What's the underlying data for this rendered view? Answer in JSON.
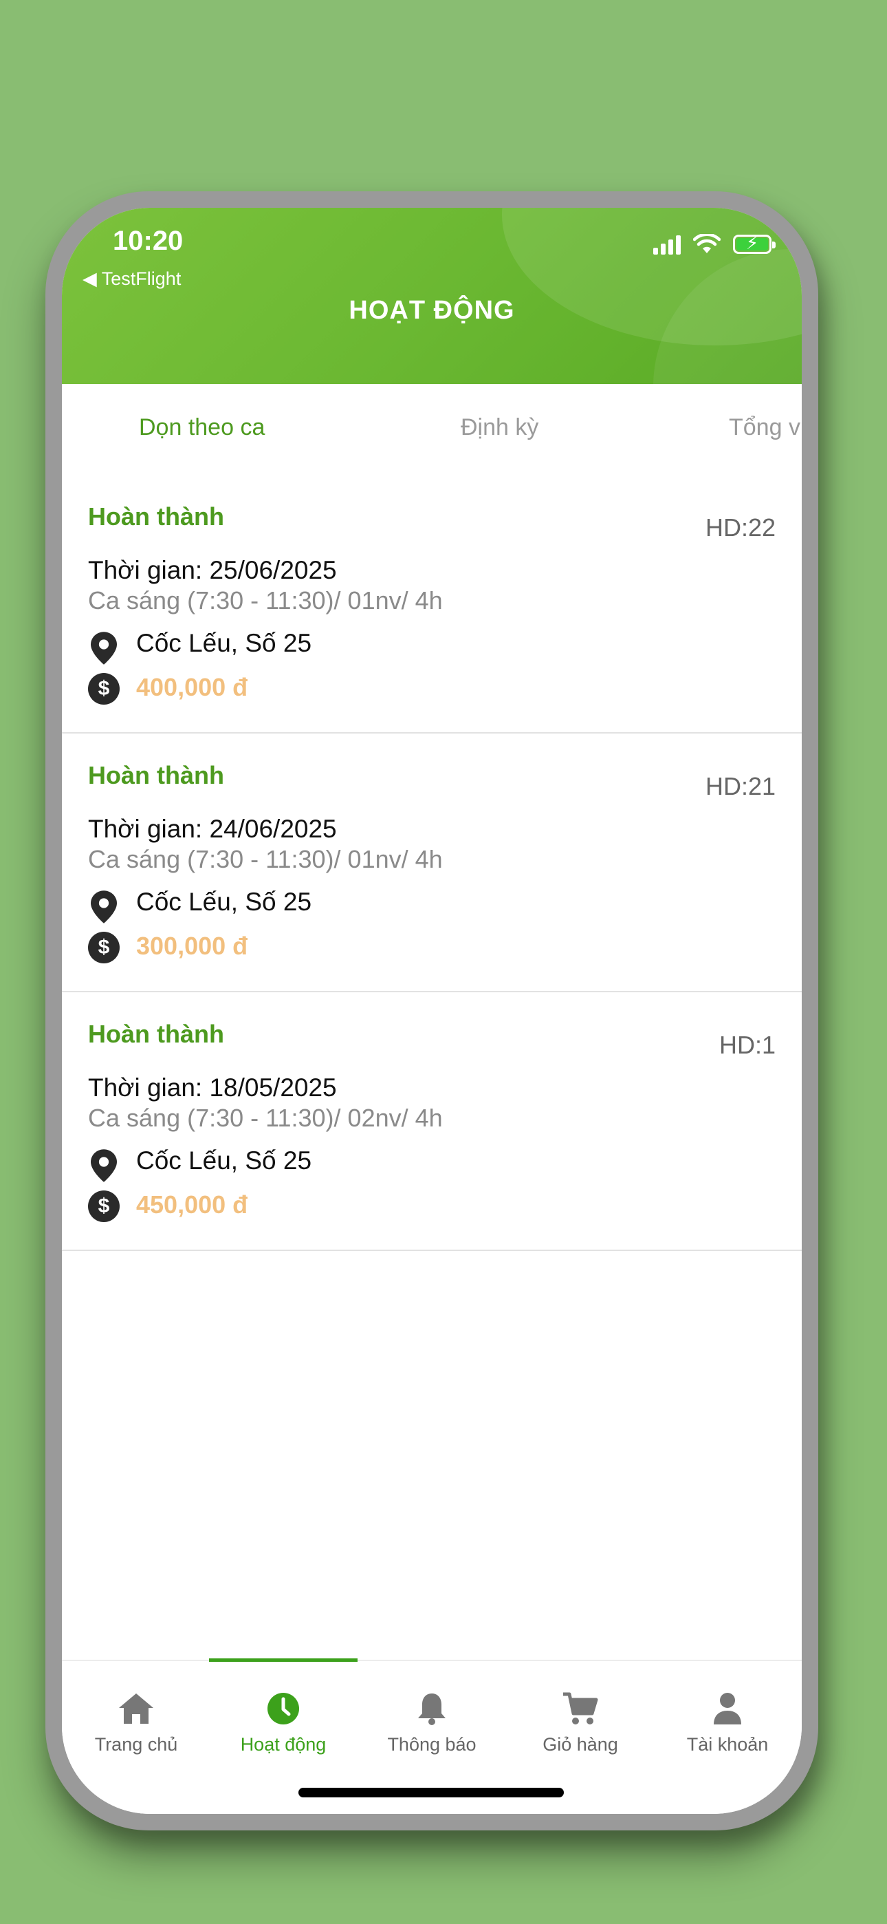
{
  "status_bar": {
    "time": "10:20",
    "back_label": "◀ TestFlight"
  },
  "header": {
    "title": "HOẠT ĐỘNG"
  },
  "tabs": [
    {
      "label": "Dọn theo ca",
      "active": true
    },
    {
      "label": "Định kỳ",
      "active": false
    },
    {
      "label": "Tổng v",
      "active": false
    }
  ],
  "orders": [
    {
      "status": "Hoàn thành",
      "code": "HD:22",
      "time": "Thời gian: 25/06/2025",
      "shift": "Ca sáng (7:30 - 11:30)/ 01nv/ 4h",
      "location": "Cốc Lếu, Số 25",
      "price": "400,000 đ"
    },
    {
      "status": "Hoàn thành",
      "code": "HD:21",
      "time": "Thời gian: 24/06/2025",
      "shift": "Ca sáng (7:30 - 11:30)/ 01nv/ 4h",
      "location": "Cốc Lếu, Số 25",
      "price": "300,000 đ"
    },
    {
      "status": "Hoàn thành",
      "code": "HD:1",
      "time": "Thời gian: 18/05/2025",
      "shift": "Ca sáng (7:30 - 11:30)/ 02nv/ 4h",
      "location": "Cốc Lếu, Số 25",
      "price": "450,000 đ"
    }
  ],
  "money_symbol": "$",
  "nav": [
    {
      "label": "Trang chủ",
      "icon": "home-icon"
    },
    {
      "label": "Hoạt động",
      "icon": "clock-icon",
      "active": true
    },
    {
      "label": "Thông báo",
      "icon": "bell-icon"
    },
    {
      "label": "Giỏ hàng",
      "icon": "cart-icon"
    },
    {
      "label": "Tài khoản",
      "icon": "user-icon"
    }
  ],
  "colors": {
    "accent": "#4d9a1f",
    "header_green": "#6bb832",
    "price": "#f2bf7e",
    "background": "#89bd72"
  }
}
